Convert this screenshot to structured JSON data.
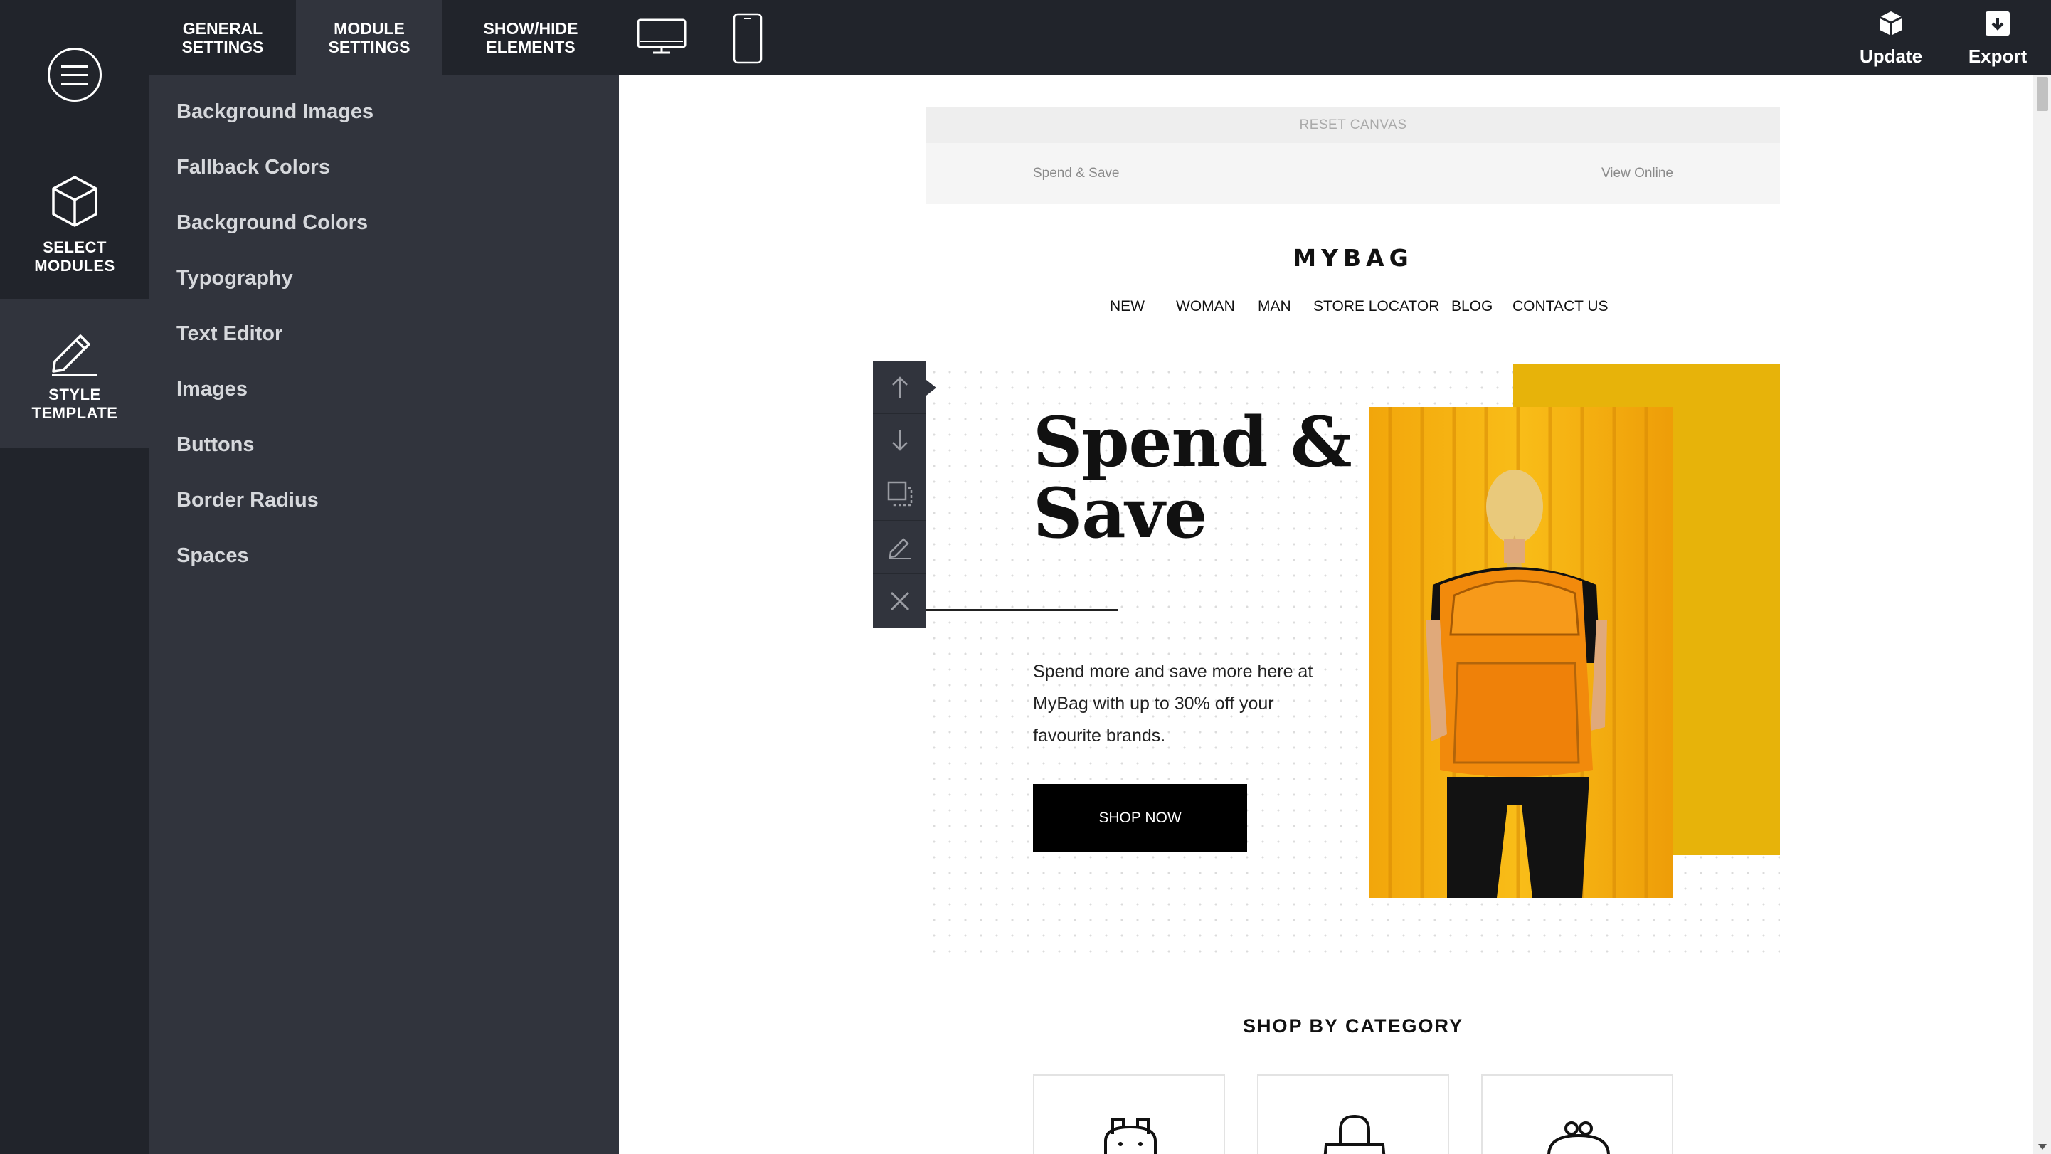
{
  "app": {
    "rail": {
      "select_modules": "SELECT\nMODULES",
      "style_template": "STYLE\nTEMPLATE"
    },
    "tabs": [
      {
        "label": "GENERAL\nSETTINGS",
        "active": false
      },
      {
        "label": "MODULE\nSETTINGS",
        "active": true
      },
      {
        "label": "SHOW/HIDE\nELEMENTS",
        "active": false
      }
    ],
    "devices": [
      "desktop-icon",
      "mobile-icon"
    ],
    "actions": {
      "update": "Update",
      "export": "Export"
    }
  },
  "panel": {
    "items": [
      "Background Images",
      "Fallback Colors",
      "Background Colors",
      "Typography",
      "Text Editor",
      "Images",
      "Buttons",
      "Border Radius",
      "Spaces"
    ]
  },
  "canvas": {
    "reset": "RESET CANVAS",
    "preheader_left": "Spend & Save",
    "preheader_right": "View Online"
  },
  "email": {
    "logo": "MYBAG",
    "nav": [
      "NEW",
      "WOMAN",
      "MAN",
      "STORE LOCATOR",
      "BLOG",
      "CONTACT US"
    ],
    "hero_title_1": "Spend &",
    "hero_title_2": "Save",
    "hero_text": "Spend more and save more here at MyBag with up to 30% off your favourite brands.",
    "cta": "SHOP NOW",
    "category_title": "SHOP BY CATEGORY"
  },
  "colors": {
    "dark": "#21242b",
    "panel": "#31343d",
    "accent_yellow": "#e7b30a",
    "button": "#000000"
  }
}
